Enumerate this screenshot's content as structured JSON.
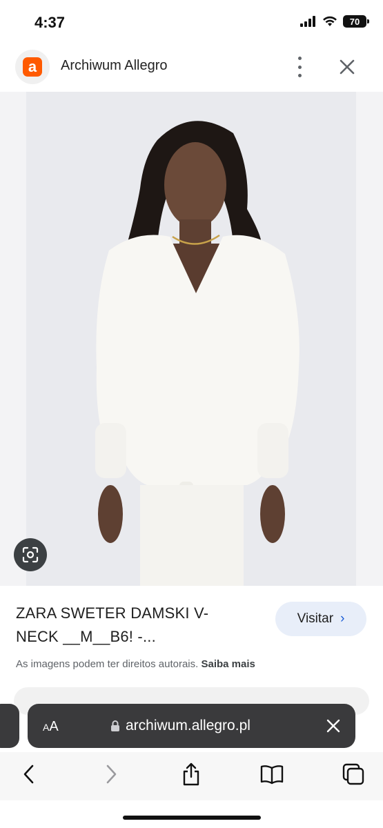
{
  "status_bar": {
    "time": "4:37",
    "battery": "70"
  },
  "header": {
    "logo_letter": "a",
    "site_name": "Archiwum Allegro"
  },
  "result": {
    "title_line1": "ZARA SWETER DAMSKI V-",
    "title_line2": "NECK __M__B6! -...",
    "visit_label": "Visitar",
    "visit_chevron": "›",
    "copyright_text": "As imagens podem ter direitos autorais.",
    "learn_more": "Saiba mais"
  },
  "browser": {
    "text_size_small": "A",
    "text_size_large": "A",
    "url": "archiwum.allegro.pl"
  },
  "icons": [
    "more-vert-icon",
    "close-icon",
    "lens-icon",
    "lock-icon",
    "back-icon",
    "forward-icon",
    "share-icon",
    "bookmarks-icon",
    "tabs-icon"
  ],
  "colors": {
    "brand": "#ff5a00",
    "link": "#1a5bd6",
    "visit_bg": "#e8eef9",
    "address_bar": "#3a3a3c"
  }
}
